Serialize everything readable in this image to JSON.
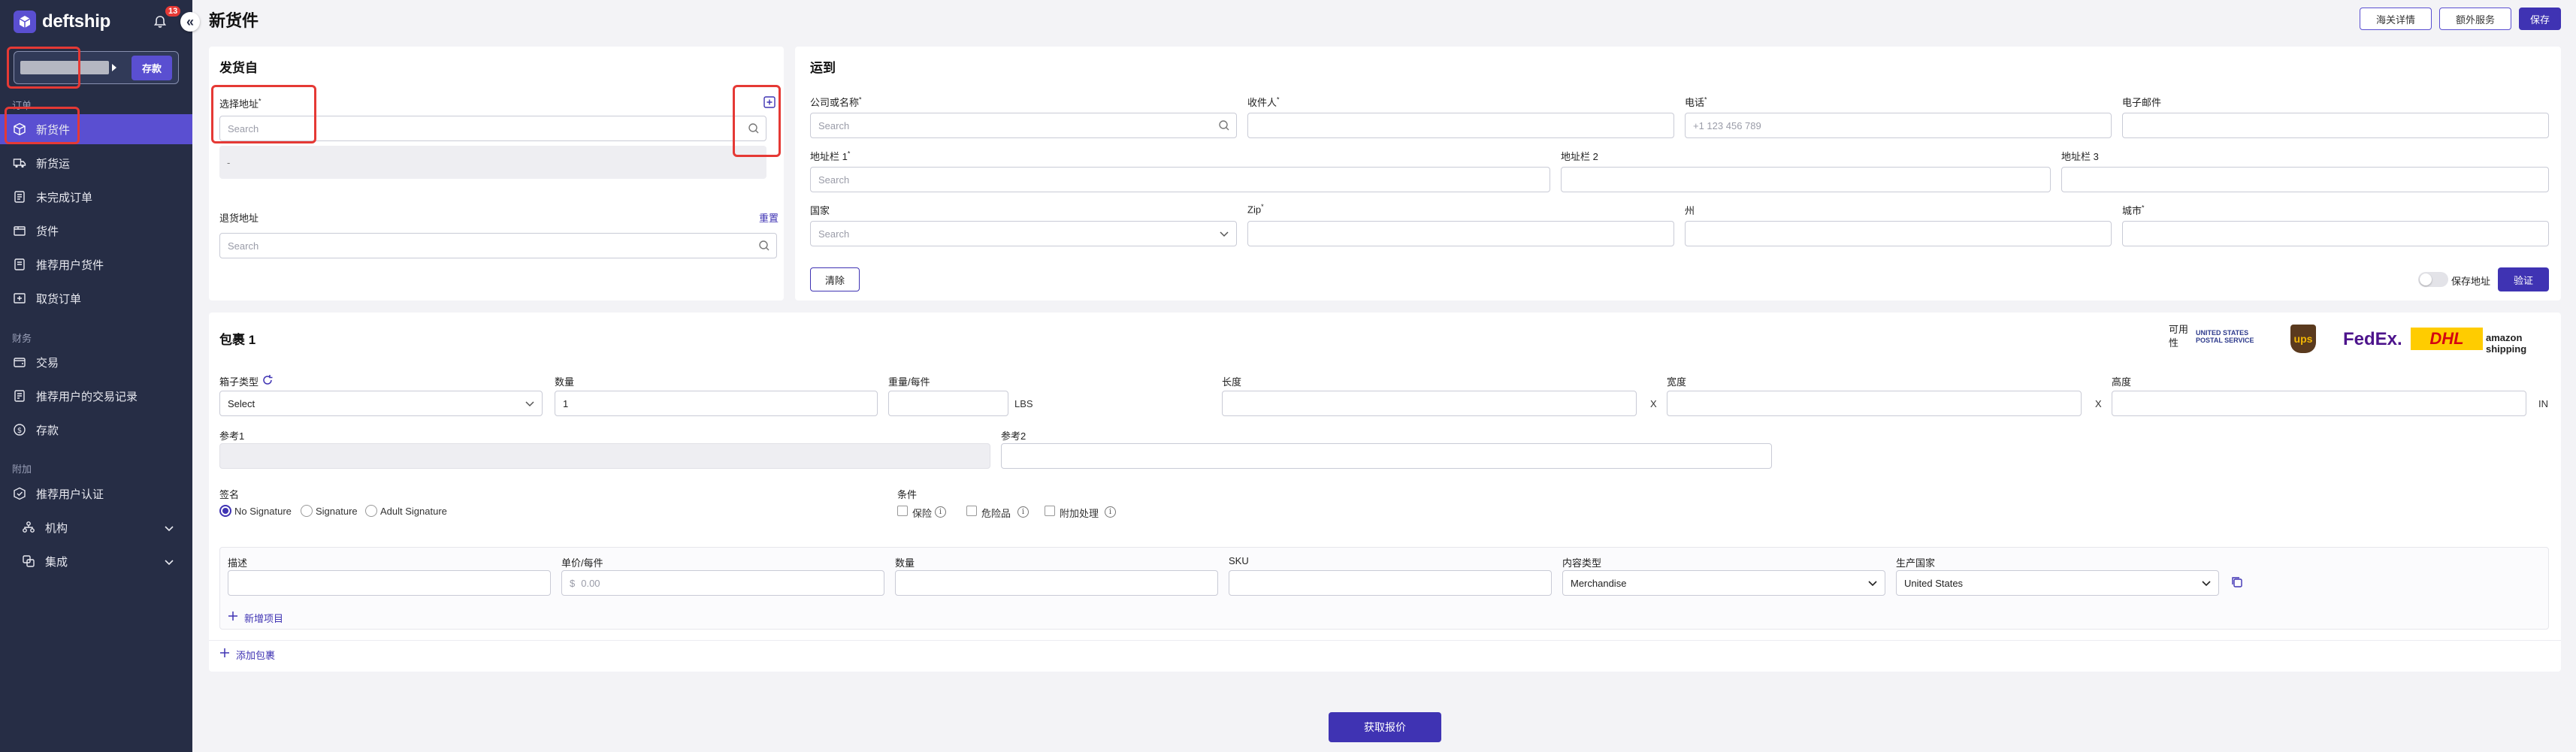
{
  "sidebar": {
    "brand": "deftship",
    "notif_count": "13",
    "collapse_glyph": "«",
    "deposit_label": "存款",
    "sections": {
      "orders": "订单",
      "finance": "财务",
      "addons": "附加"
    },
    "items": [
      {
        "label": "新货件",
        "icon": "box-icon"
      },
      {
        "label": "新货运",
        "icon": "truck-icon"
      },
      {
        "label": "未完成订单",
        "icon": "list-icon"
      },
      {
        "label": "货件",
        "icon": "package-icon"
      },
      {
        "label": "推荐用户货件",
        "icon": "referral-shipment-icon"
      },
      {
        "label": "取货订单",
        "icon": "pickup-icon"
      },
      {
        "label": "交易",
        "icon": "wallet-icon"
      },
      {
        "label": "推荐用户的交易记录",
        "icon": "receipt-icon"
      },
      {
        "label": "存款",
        "icon": "dollar-icon"
      },
      {
        "label": "推荐用户认证",
        "icon": "badge-icon"
      },
      {
        "label": "机构",
        "icon": "org-icon"
      },
      {
        "label": "集成",
        "icon": "integration-icon"
      }
    ]
  },
  "header": {
    "title": "新货件",
    "customs_button": "海关详情",
    "extra_services_button": "额外服务",
    "save_button": "保存"
  },
  "ship_from": {
    "title": "发货自",
    "select_address_label": "选择地址",
    "select_address_placeholder": "Search",
    "address_preview": "-",
    "return_address_label": "退货地址",
    "reset_link": "重置",
    "return_address_placeholder": "Search"
  },
  "ship_to": {
    "title": "运到",
    "company_label": "公司或名称",
    "company_placeholder": "Search",
    "recipient_label": "收件人",
    "phone_label": "电话",
    "phone_placeholder": "+1 123 456 789",
    "email_label": "电子邮件",
    "address1_label": "地址栏 1",
    "address1_placeholder": "Search",
    "address2_label": "地址栏 2",
    "address3_label": "地址栏 3",
    "country_label": "国家",
    "country_placeholder": "Search",
    "zip_label": "Zip",
    "state_label": "州",
    "city_label": "城市",
    "clear_button": "清除",
    "save_address_label": "保存地址",
    "verify_button": "验证"
  },
  "package": {
    "title": "包裹 1",
    "available_label": "可用性",
    "carriers": [
      "UNITED STATES POSTAL SERVICE",
      "ups",
      "FedEx.",
      "DHL",
      "amazon shipping"
    ],
    "box_type_label": "箱子类型",
    "box_type_value": "Select",
    "quantity_label": "数量",
    "quantity_value": "1",
    "weight_label": "重量/每件",
    "weight_unit": "LBS",
    "length_label": "长度",
    "width_label": "宽度",
    "height_label": "高度",
    "dim_separator": "X",
    "dim_unit": "IN",
    "ref1_label": "参考1",
    "ref2_label": "参考2",
    "signature_label": "签名",
    "signature_options": [
      "No Signature",
      "Signature",
      "Adult Signature"
    ],
    "conditions_label": "条件",
    "condition_options": [
      "保险",
      "危险品",
      "附加处理"
    ],
    "info_glyph": "i"
  },
  "items_table": {
    "columns": [
      "描述",
      "单价/每件",
      "数量",
      "SKU",
      "内容类型",
      "生产国家"
    ],
    "price_prefix": "$",
    "price_placeholder": "0.00",
    "content_type_value": "Merchandise",
    "country_value": "United States",
    "add_item_label": "新增项目"
  },
  "add_package_label": "添加包裹",
  "get_quote_button": "获取报价",
  "colors": {
    "primary": "#3f33b3",
    "sidebar_bg": "#262d45",
    "highlight_box": "#e53935"
  }
}
